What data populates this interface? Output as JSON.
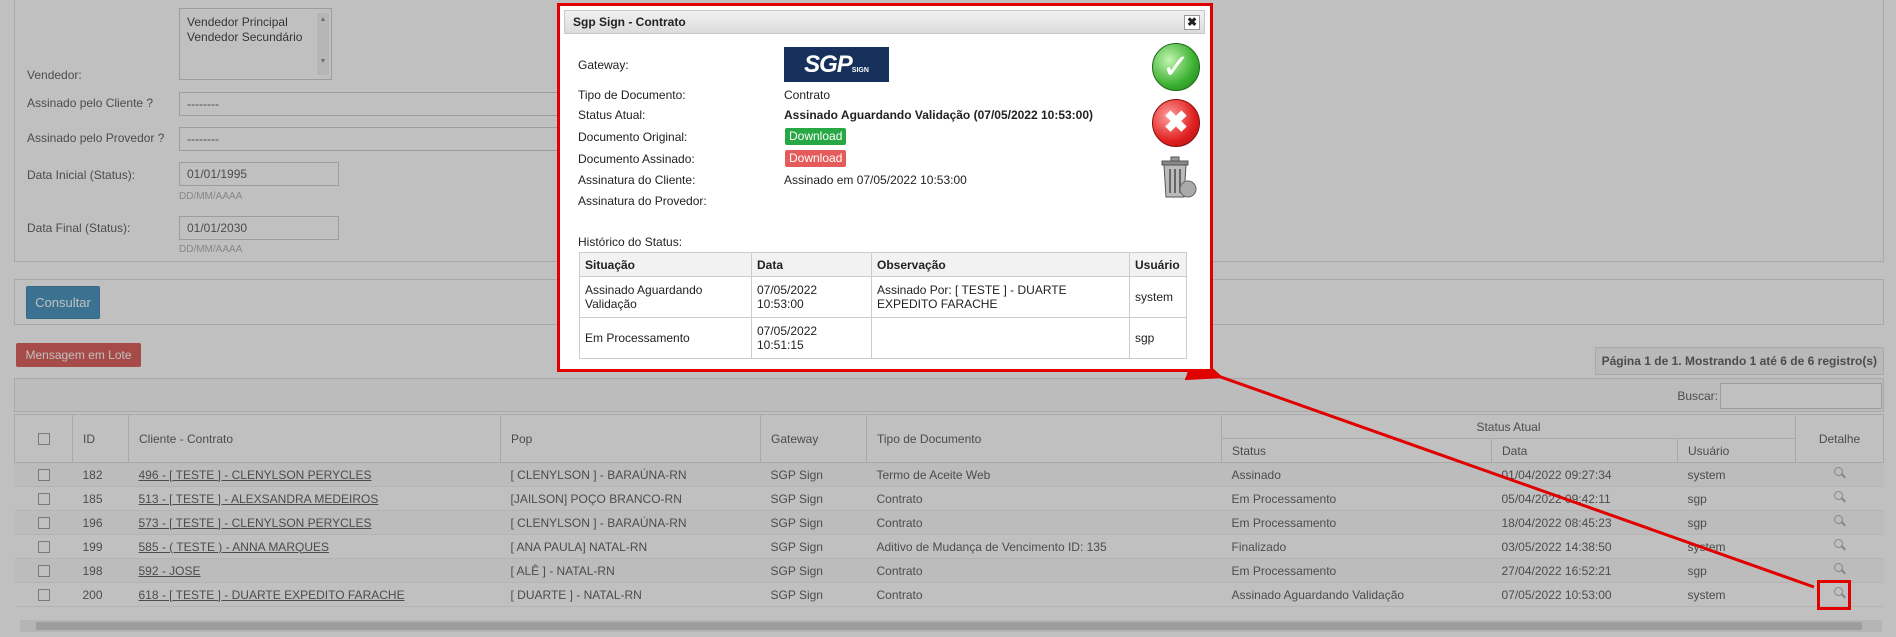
{
  "filters": {
    "vendedor_label": "Vendedor:",
    "vendedor_options": [
      "Vendedor Principal",
      "Vendedor Secundário"
    ],
    "assinado_cliente_label": "Assinado pelo Cliente ?",
    "assinado_cliente_value": "--------",
    "assinado_provedor_label": "Assinado pelo Provedor ?",
    "assinado_provedor_value": "--------",
    "data_inicial_label": "Data Inicial (Status):",
    "data_inicial_value": "01/01/1995",
    "data_inicial_hint": "DD/MM/AAAA",
    "data_final_label": "Data Final (Status):",
    "data_final_value": "01/01/2030",
    "data_final_hint": "DD/MM/AAAA"
  },
  "consultar_label": "Consultar",
  "mensagem_lote_label": "Mensagem em Lote",
  "pager_info": "Página 1 de 1. Mostrando 1 até 6 de 6 registro(s)",
  "search_label": "Buscar:",
  "table": {
    "headers": {
      "id": "ID",
      "cliente": "Cliente - Contrato",
      "pop": "Pop",
      "gateway": "Gateway",
      "tipo": "Tipo de Documento",
      "status_atual": "Status Atual",
      "status": "Status",
      "data": "Data",
      "usuario": "Usuário",
      "detalhe": "Detalhe"
    },
    "rows": [
      {
        "id": "182",
        "cliente": "496 - [ TESTE ] - CLENYLSON PERYCLES",
        "pop": "[ CLENYLSON ] - BARAÚNA-RN",
        "gateway": "SGP Sign",
        "tipo": "Termo de Aceite Web",
        "status": "Assinado",
        "data": "01/04/2022 09:27:34",
        "usuario": "system"
      },
      {
        "id": "185",
        "cliente": "513 - [ TESTE ] - ALEXSANDRA MEDEIROS",
        "pop": "[JAILSON] POÇO BRANCO-RN",
        "gateway": "SGP Sign",
        "tipo": "Contrato",
        "status": "Em Processamento",
        "data": "05/04/2022 09:42:11",
        "usuario": "sgp"
      },
      {
        "id": "196",
        "cliente": "573 - [ TESTE ] - CLENYLSON PERYCLES",
        "pop": "[ CLENYLSON ] - BARAÚNA-RN",
        "gateway": "SGP Sign",
        "tipo": "Contrato",
        "status": "Em Processamento",
        "data": "18/04/2022 08:45:23",
        "usuario": "sgp"
      },
      {
        "id": "199",
        "cliente": "585 - ( TESTE ) - ANNA MARQUES",
        "pop": "[ ANA PAULA] NATAL-RN",
        "gateway": "SGP Sign",
        "tipo": "Aditivo de Mudança de Vencimento ID: 135",
        "status": "Finalizado",
        "data": "03/05/2022 14:38:50",
        "usuario": "system"
      },
      {
        "id": "198",
        "cliente": "592 - JOSE",
        "pop": "[ ALÊ ] - NATAL-RN",
        "gateway": "SGP Sign",
        "tipo": "Contrato",
        "status": "Em Processamento",
        "data": "27/04/2022 16:52:21",
        "usuario": "sgp"
      },
      {
        "id": "200",
        "cliente": "618 - [ TESTE ] - DUARTE EXPEDITO FARACHE",
        "pop": "[ DUARTE ] - NATAL-RN",
        "gateway": "SGP Sign",
        "tipo": "Contrato",
        "status": "Assinado Aguardando Validação",
        "data": "07/05/2022 10:53:00",
        "usuario": "system"
      }
    ]
  },
  "dialog": {
    "title": "Sgp Sign - Contrato",
    "close": "✖",
    "logo_text": "SGP",
    "logo_sub": "SIGN",
    "gateway_label": "Gateway:",
    "tipo_label": "Tipo de Documento:",
    "tipo_value": "Contrato",
    "status_label": "Status Atual:",
    "status_value": "Assinado Aguardando Validação (07/05/2022 10:53:00)",
    "doc_original_label": "Documento Original:",
    "doc_original_btn": "Download",
    "doc_assinado_label": "Documento Assinado:",
    "doc_assinado_btn": "Download",
    "ass_cliente_label": "Assinatura do Cliente:",
    "ass_cliente_value": "Assinado em 07/05/2022 10:53:00",
    "ass_provedor_label": "Assinatura do Provedor:",
    "historico_label": "Histórico do Status:",
    "hist_headers": {
      "situacao": "Situação",
      "data": "Data",
      "observacao": "Observação",
      "usuario": "Usuário"
    },
    "hist_rows": [
      {
        "situacao": "Assinado Aguardando Validação",
        "data": "07/05/2022 10:53:00",
        "observacao": "Assinado Por: [ TESTE ] - DUARTE EXPEDITO FARACHE",
        "usuario": "system"
      },
      {
        "situacao": "Em Processamento",
        "data": "07/05/2022 10:51:15",
        "observacao": "",
        "usuario": "sgp"
      }
    ]
  },
  "colors": {
    "highlight": "#e00000",
    "download_original": "#28a745",
    "download_assinado": "#e35b5b",
    "consultar": "#3c8dbc",
    "lote": "#d9534f"
  }
}
